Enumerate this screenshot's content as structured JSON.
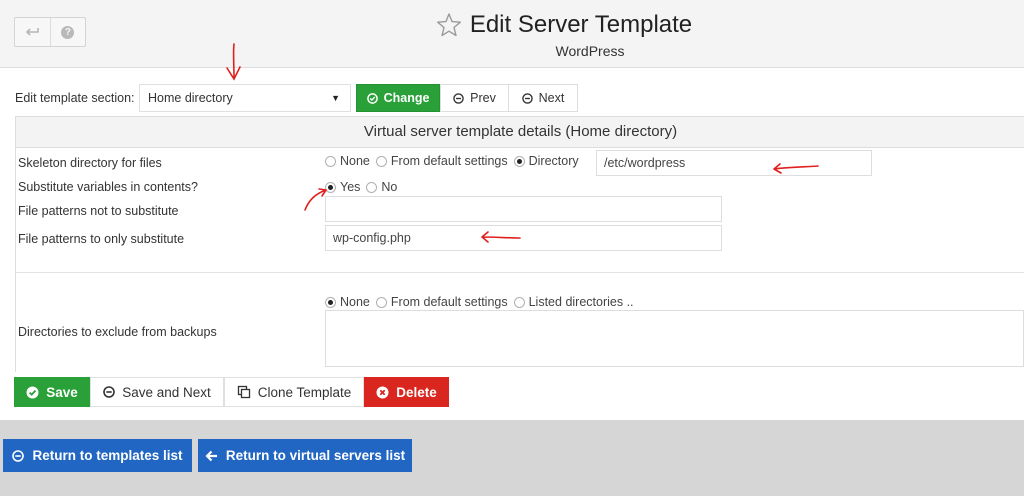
{
  "header": {
    "title": "Edit Server Template",
    "subtitle": "WordPress",
    "back_icon": "back-arrow-icon",
    "help_icon": "help-icon",
    "favorite_icon": "star-icon"
  },
  "section": {
    "label": "Edit template section:",
    "selected": "Home directory",
    "change_label": "Change",
    "prev_label": "Prev",
    "next_label": "Next"
  },
  "form": {
    "heading": "Virtual server template details (Home directory)",
    "skeleton": {
      "label": "Skeleton directory for files",
      "options": [
        "None",
        "From default settings",
        "Directory"
      ],
      "selected": "Directory",
      "value": "/etc/wordpress"
    },
    "substitute": {
      "label": "Substitute variables in contents?",
      "options": [
        "Yes",
        "No"
      ],
      "selected": "Yes"
    },
    "patterns_not": {
      "label": "File patterns not to substitute",
      "value": ""
    },
    "patterns_only": {
      "label": "File patterns to only substitute",
      "value": "wp-config.php"
    },
    "exclude": {
      "label": "Directories to exclude from backups",
      "options": [
        "None",
        "From default settings",
        "Listed directories .."
      ],
      "selected": "None"
    }
  },
  "actions": {
    "save": "Save",
    "save_next": "Save and Next",
    "clone": "Clone Template",
    "delete": "Delete"
  },
  "bottom": {
    "return_templates": "Return to templates list",
    "return_servers": "Return to virtual servers list"
  },
  "colors": {
    "green": "#29a038",
    "red": "#d9261f",
    "blue": "#2166c2",
    "annotation": "#e0201e"
  }
}
